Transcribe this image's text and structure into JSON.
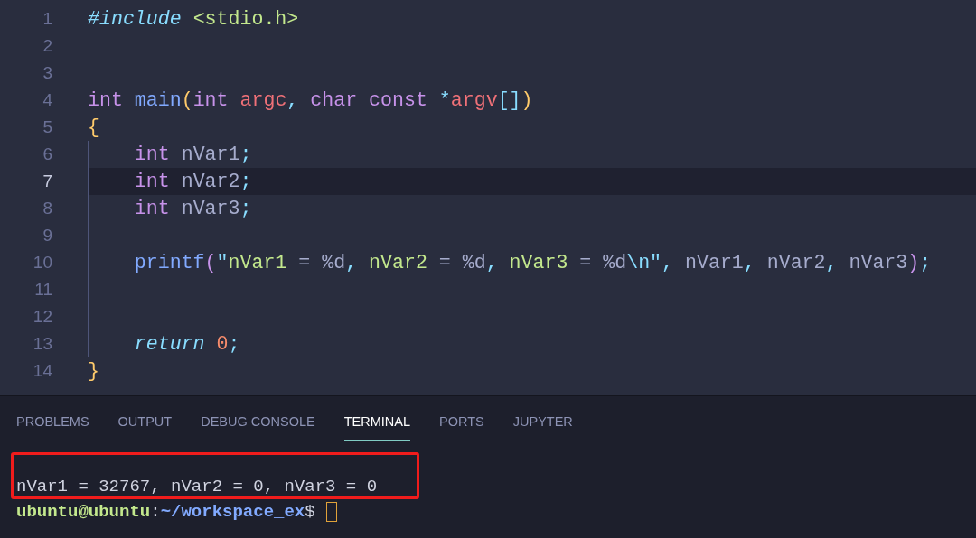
{
  "editor": {
    "lines": [
      {
        "number": "1",
        "current": false,
        "tokens": [
          {
            "kind": "directive",
            "text": "#include"
          },
          {
            "kind": "string",
            "text": " <stdio.h>"
          }
        ]
      },
      {
        "number": "2",
        "current": false
      },
      {
        "number": "3",
        "current": false
      },
      {
        "number": "4",
        "current": false,
        "tokens": [
          {
            "kind": "keyword",
            "text": "int"
          },
          {
            "kind": "function",
            "text": " main"
          },
          {
            "kind": "bracket",
            "text": "("
          },
          {
            "kind": "keyword",
            "text": "int"
          },
          {
            "kind": "param",
            "text": " argc"
          },
          {
            "kind": "punct",
            "text": ","
          },
          {
            "kind": "keyword",
            "text": " char const"
          },
          {
            "kind": "punct",
            "text": " *"
          },
          {
            "kind": "param",
            "text": "argv"
          },
          {
            "kind": "punct",
            "text": "[]"
          },
          {
            "kind": "bracket",
            "text": ")"
          }
        ]
      },
      {
        "number": "5",
        "current": false,
        "tokens": [
          {
            "kind": "bracket",
            "text": "{"
          }
        ],
        "children": [
          {
            "number": "6",
            "current": false,
            "tokens": [
              {
                "kind": "keyword",
                "text": "int"
              },
              {
                "kind": "plain",
                "text": " nVar1"
              },
              {
                "kind": "punct",
                "text": ";"
              }
            ]
          },
          {
            "number": "7",
            "current": true,
            "tokens": [
              {
                "kind": "keyword",
                "text": "int"
              },
              {
                "kind": "plain",
                "text": " nVar2"
              },
              {
                "kind": "punct",
                "text": ";"
              }
            ]
          },
          {
            "number": "8",
            "current": false,
            "tokens": [
              {
                "kind": "keyword",
                "text": "int"
              },
              {
                "kind": "plain",
                "text": " nVar3"
              },
              {
                "kind": "punct",
                "text": ";"
              }
            ]
          },
          {
            "number": "9",
            "current": false
          },
          {
            "number": "10",
            "current": false,
            "tokens": [
              {
                "kind": "function",
                "text": "printf"
              },
              {
                "kind": "call_paren",
                "text": "("
              },
              {
                "kind": "punct",
                "text": "\""
              },
              {
                "kind": "string",
                "text": "nVar1"
              },
              {
                "kind": "plain",
                "text": " = %d"
              },
              {
                "kind": "punct",
                "text": ","
              },
              {
                "kind": "string",
                "text": " nVar2"
              },
              {
                "kind": "plain",
                "text": " = %d"
              },
              {
                "kind": "punct",
                "text": ","
              },
              {
                "kind": "string",
                "text": " nVar3"
              },
              {
                "kind": "plain",
                "text": " = %d"
              },
              {
                "kind": "punct",
                "text": "\\n\""
              },
              {
                "kind": "punct",
                "text": ","
              },
              {
                "kind": "plain",
                "text": " nVar1"
              },
              {
                "kind": "punct",
                "text": ","
              },
              {
                "kind": "plain",
                "text": " nVar2"
              },
              {
                "kind": "punct",
                "text": ","
              },
              {
                "kind": "plain",
                "text": " nVar3"
              },
              {
                "kind": "call_paren",
                "text": ")"
              },
              {
                "kind": "punct",
                "text": ";"
              }
            ]
          },
          {
            "number": "11",
            "current": false
          },
          {
            "number": "12",
            "current": false
          },
          {
            "number": "13",
            "current": false,
            "tokens": [
              {
                "kind": "control",
                "text": "return"
              },
              {
                "kind": "number",
                "text": " 0"
              },
              {
                "kind": "punct",
                "text": ";"
              }
            ]
          }
        ]
      },
      {
        "number": "14",
        "current": false,
        "tokens": [
          {
            "kind": "bracket",
            "text": "}"
          }
        ]
      }
    ]
  },
  "panel": {
    "tabs": [
      {
        "label": "PROBLEMS",
        "selected": false
      },
      {
        "label": "OUTPUT",
        "selected": false
      },
      {
        "label": "DEBUG CONSOLE",
        "selected": false
      },
      {
        "label": "TERMINAL",
        "selected": true
      },
      {
        "label": "PORTS",
        "selected": false
      },
      {
        "label": "JUPYTER",
        "selected": false
      }
    ]
  },
  "terminal": {
    "output": "nVar1 = 32767, nVar2 = 0, nVar3 = 0",
    "annotated": true,
    "prompt": [
      {
        "kind": "user",
        "text": "ubuntu@ubuntu"
      },
      {
        "kind": "plain",
        "text": ":"
      },
      {
        "kind": "path",
        "text": "~/workspace_ex"
      },
      {
        "kind": "plain",
        "text": "$"
      }
    ],
    "cursor": true
  }
}
